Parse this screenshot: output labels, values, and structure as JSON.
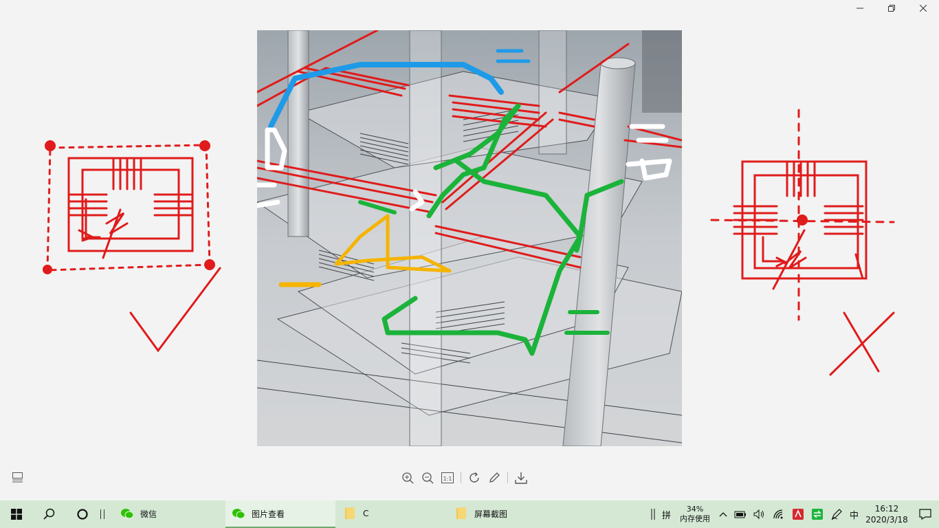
{
  "window": {
    "minimize_icon": "minimize-icon",
    "restore_icon": "restore-icon",
    "close_icon": "close-icon"
  },
  "viewer": {
    "bottom_left_icon": "thumbnail-strip-icon",
    "tools": [
      "zoom-in-icon",
      "zoom-out-icon",
      "actual-size-icon",
      "rotate-icon",
      "edit-icon",
      "download-icon"
    ],
    "actual_size_label": "1:1"
  },
  "taskbar": {
    "apps": [
      {
        "label": "微信",
        "icon": "wechat-icon",
        "state": "normal"
      },
      {
        "label": "图片查看",
        "icon": "wechat-icon",
        "state": "active"
      },
      {
        "label": "C",
        "icon": "folder-icon",
        "state": "normal"
      },
      {
        "label": "屏幕截图",
        "icon": "folder-icon",
        "state": "normal"
      }
    ],
    "ime_mode": "拼",
    "memory_percent": "34%",
    "memory_label": "内存使用",
    "language": "中",
    "time": "16:12",
    "date": "2020/3/18"
  },
  "colors": {
    "taskbar_bg": "#d4e8d4",
    "sketch_red": "#e01b1b",
    "sketch_blue": "#1e9ae8",
    "sketch_green": "#1bb33a",
    "sketch_yellow": "#f5b400"
  }
}
